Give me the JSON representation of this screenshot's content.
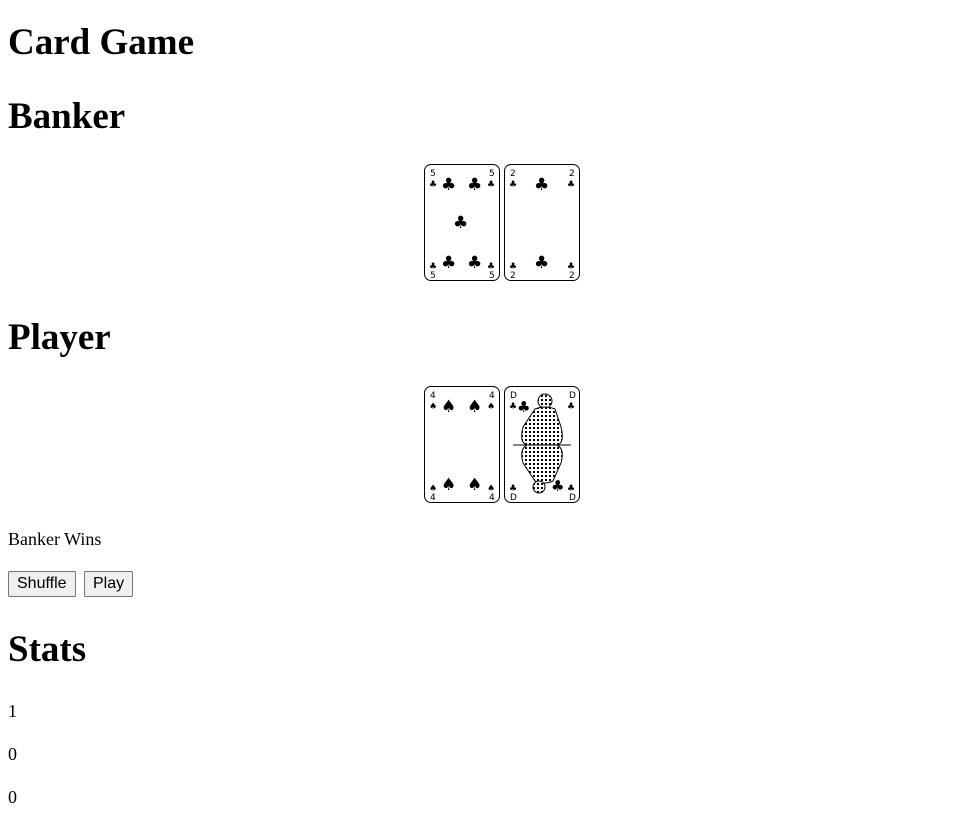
{
  "title": "Card Game",
  "banker": {
    "heading": "Banker",
    "cards": [
      {
        "rank": "5",
        "suit": "clubs",
        "suit_symbol": "♣",
        "icon": "five-of-clubs-card"
      },
      {
        "rank": "2",
        "suit": "clubs",
        "suit_symbol": "♣",
        "icon": "two-of-clubs-card"
      }
    ]
  },
  "player": {
    "heading": "Player",
    "cards": [
      {
        "rank": "4",
        "suit": "spades",
        "suit_symbol": "♠",
        "icon": "four-of-spades-card"
      },
      {
        "rank": "D",
        "suit": "clubs",
        "suit_symbol": "♣",
        "icon": "queen-of-clubs-card"
      }
    ]
  },
  "result_text": "Banker Wins",
  "controls": {
    "shuffle_label": "Shuffle",
    "play_label": "Play"
  },
  "stats": {
    "heading": "Stats",
    "values": [
      "1",
      "0",
      "0"
    ]
  }
}
